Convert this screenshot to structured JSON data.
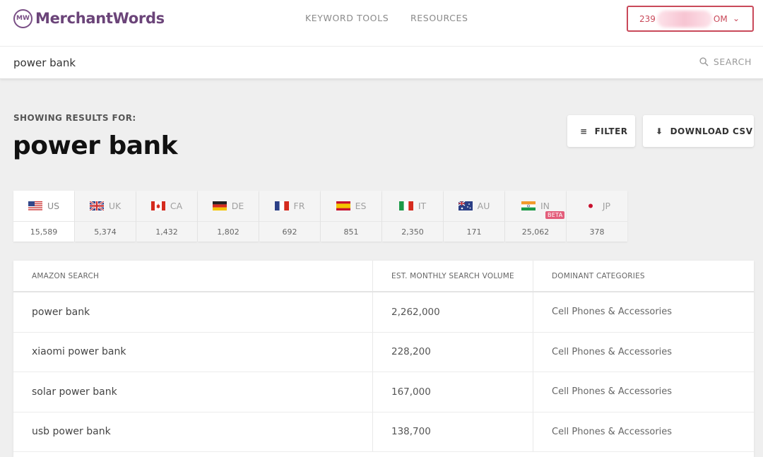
{
  "header": {
    "brand": "MerchantWords",
    "logo_mark": "MW",
    "nav": [
      "KEYWORD TOOLS",
      "RESOURCES"
    ],
    "account_prefix": "239",
    "account_suffix": "OM"
  },
  "search": {
    "value": "power bank",
    "button_label": "SEARCH"
  },
  "results_header": {
    "showing_label": "SHOWING RESULTS FOR:",
    "query": "power bank",
    "filter_label": "FILTER",
    "download_label": "DOWNLOAD CSV"
  },
  "countries": [
    {
      "code": "US",
      "count": "15,589",
      "flag": "us-flag-icon"
    },
    {
      "code": "UK",
      "count": "5,374",
      "flag": "uk-flag-icon"
    },
    {
      "code": "CA",
      "count": "1,432",
      "flag": "ca-flag-icon"
    },
    {
      "code": "DE",
      "count": "1,802",
      "flag": "de-flag-icon"
    },
    {
      "code": "FR",
      "count": "692",
      "flag": "fr-flag-icon"
    },
    {
      "code": "ES",
      "count": "851",
      "flag": "es-flag-icon"
    },
    {
      "code": "IT",
      "count": "2,350",
      "flag": "it-flag-icon"
    },
    {
      "code": "AU",
      "count": "171",
      "flag": "au-flag-icon"
    },
    {
      "code": "IN",
      "count": "25,062",
      "flag": "in-flag-icon",
      "badge": "BETA"
    },
    {
      "code": "JP",
      "count": "378",
      "flag": "jp-flag-icon"
    }
  ],
  "table": {
    "columns": [
      "AMAZON SEARCH",
      "EST. MONTHLY SEARCH VOLUME",
      "DOMINANT CATEGORIES"
    ],
    "rows": [
      {
        "search": "power bank",
        "volume": "2,262,000",
        "category": "Cell Phones & Accessories"
      },
      {
        "search": "xiaomi power bank",
        "volume": "228,200",
        "category": "Cell Phones & Accessories"
      },
      {
        "search": "solar power bank",
        "volume": "167,000",
        "category": "Cell Phones & Accessories"
      },
      {
        "search": "usb power bank",
        "volume": "138,700",
        "category": "Cell Phones & Accessories"
      }
    ]
  },
  "colors": {
    "brand": "#6b4479",
    "accent": "#c9495a",
    "beta_badge": "#e35d7a"
  }
}
